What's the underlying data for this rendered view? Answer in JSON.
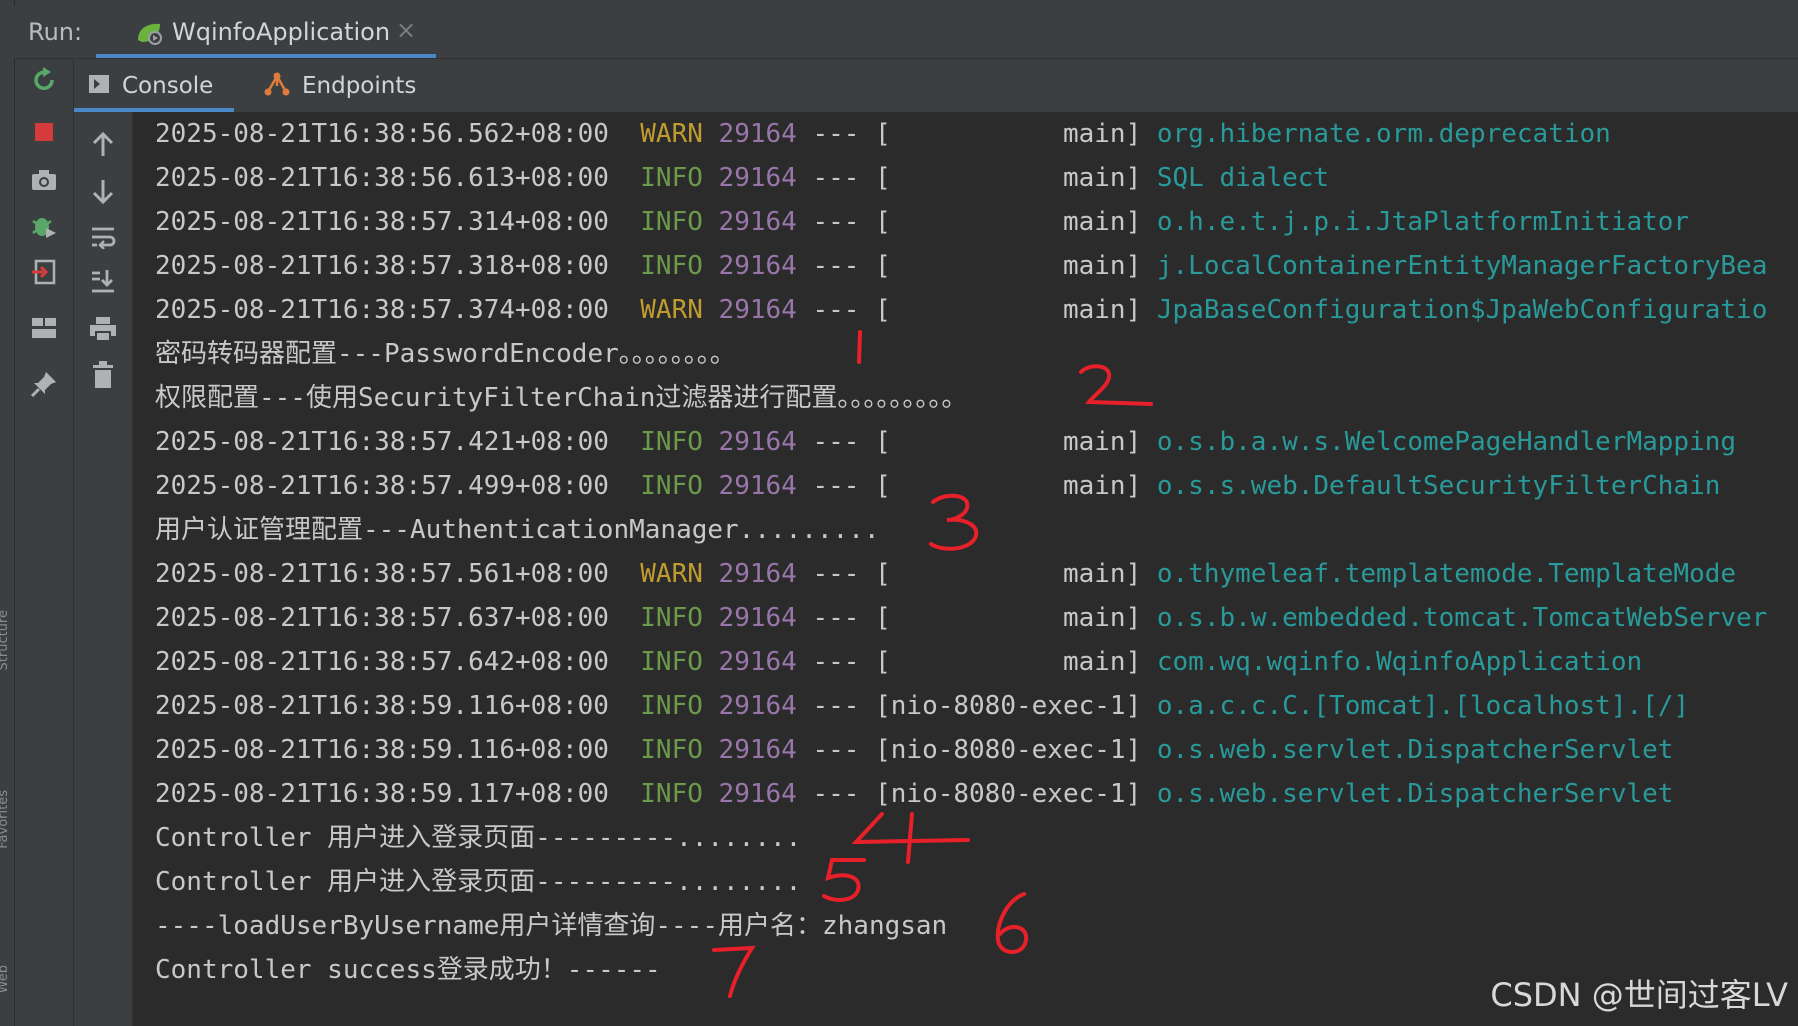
{
  "run_panel": {
    "label": "Run:",
    "tab_title": "WqinfoApplication",
    "close_glyph": "×"
  },
  "console_tabs": [
    {
      "label": "Console",
      "icon": "console-icon",
      "active": true
    },
    {
      "label": "Endpoints",
      "icon": "endpoints-icon",
      "active": false
    }
  ],
  "side_labels": {
    "structure": "Structure",
    "favorites": "Favorites",
    "web": "Web"
  },
  "left_toolbar": [
    "rerun-icon",
    "stop-icon",
    "camera-icon",
    "debug-icon",
    "exit-icon",
    "layout-icon",
    "pin-icon"
  ],
  "right_toolbar": [
    "arrow-up-icon",
    "arrow-down-icon",
    "soft-wrap-icon",
    "scroll-to-end-icon",
    "print-icon",
    "trash-icon"
  ],
  "colors": {
    "warn": "#bf9b30",
    "info": "#6a9a4a",
    "pid": "#9876aa",
    "logger": "#299999",
    "annotation": "#e8202a"
  },
  "log_lines": [
    {
      "kind": "log",
      "ts": "2025-08-21T16:38:56.562+08:00",
      "level": "WARN",
      "pid": "29164",
      "sep": "---",
      "thread": "[           main]",
      "logger": "org.hibernate.orm.deprecation"
    },
    {
      "kind": "log",
      "ts": "2025-08-21T16:38:56.613+08:00",
      "level": "INFO",
      "pid": "29164",
      "sep": "---",
      "thread": "[           main]",
      "logger": "SQL dialect"
    },
    {
      "kind": "log",
      "ts": "2025-08-21T16:38:57.314+08:00",
      "level": "INFO",
      "pid": "29164",
      "sep": "---",
      "thread": "[           main]",
      "logger": "o.h.e.t.j.p.i.JtaPlatformInitiator"
    },
    {
      "kind": "log",
      "ts": "2025-08-21T16:38:57.318+08:00",
      "level": "INFO",
      "pid": "29164",
      "sep": "---",
      "thread": "[           main]",
      "logger": "j.LocalContainerEntityManagerFactoryBea"
    },
    {
      "kind": "log",
      "ts": "2025-08-21T16:38:57.374+08:00",
      "level": "WARN",
      "pid": "29164",
      "sep": "---",
      "thread": "[           main]",
      "logger": "JpaBaseConfiguration$JpaWebConfiguratio"
    },
    {
      "kind": "text",
      "text": "密码转码器配置---PasswordEncoder。。。。。。。。"
    },
    {
      "kind": "text",
      "text": "权限配置---使用SecurityFilterChain过滤器进行配置。。。。。。。。。"
    },
    {
      "kind": "log",
      "ts": "2025-08-21T16:38:57.421+08:00",
      "level": "INFO",
      "pid": "29164",
      "sep": "---",
      "thread": "[           main]",
      "logger": "o.s.b.a.w.s.WelcomePageHandlerMapping"
    },
    {
      "kind": "log",
      "ts": "2025-08-21T16:38:57.499+08:00",
      "level": "INFO",
      "pid": "29164",
      "sep": "---",
      "thread": "[           main]",
      "logger": "o.s.s.web.DefaultSecurityFilterChain"
    },
    {
      "kind": "text",
      "text": "用户认证管理配置---AuthenticationManager........."
    },
    {
      "kind": "log",
      "ts": "2025-08-21T16:38:57.561+08:00",
      "level": "WARN",
      "pid": "29164",
      "sep": "---",
      "thread": "[           main]",
      "logger": "o.thymeleaf.templatemode.TemplateMode"
    },
    {
      "kind": "log",
      "ts": "2025-08-21T16:38:57.637+08:00",
      "level": "INFO",
      "pid": "29164",
      "sep": "---",
      "thread": "[           main]",
      "logger": "o.s.b.w.embedded.tomcat.TomcatWebServer"
    },
    {
      "kind": "log",
      "ts": "2025-08-21T16:38:57.642+08:00",
      "level": "INFO",
      "pid": "29164",
      "sep": "---",
      "thread": "[           main]",
      "logger": "com.wq.wqinfo.WqinfoApplication"
    },
    {
      "kind": "log",
      "ts": "2025-08-21T16:38:59.116+08:00",
      "level": "INFO",
      "pid": "29164",
      "sep": "---",
      "thread": "[nio-8080-exec-1]",
      "logger": "o.a.c.c.C.[Tomcat].[localhost].[/]"
    },
    {
      "kind": "log",
      "ts": "2025-08-21T16:38:59.116+08:00",
      "level": "INFO",
      "pid": "29164",
      "sep": "---",
      "thread": "[nio-8080-exec-1]",
      "logger": "o.s.web.servlet.DispatcherServlet"
    },
    {
      "kind": "log",
      "ts": "2025-08-21T16:38:59.117+08:00",
      "level": "INFO",
      "pid": "29164",
      "sep": "---",
      "thread": "[nio-8080-exec-1]",
      "logger": "o.s.web.servlet.DispatcherServlet"
    },
    {
      "kind": "text",
      "text": "Controller 用户进入登录页面---------........"
    },
    {
      "kind": "text",
      "text": "Controller 用户进入登录页面---------........"
    },
    {
      "kind": "text",
      "text": "----loadUserByUsername用户详情查询----用户名：zhangsan"
    },
    {
      "kind": "text",
      "text": "Controller success登录成功！------"
    }
  ],
  "annotations": [
    "1",
    "2",
    "3",
    "4",
    "5",
    "6",
    "7"
  ],
  "watermark": "CSDN @世间过客LV"
}
